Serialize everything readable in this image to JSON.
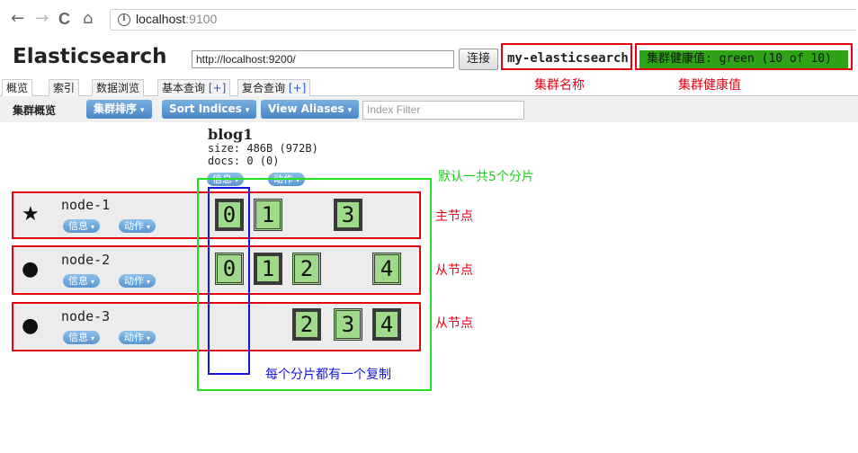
{
  "browser": {
    "nav_back": "←",
    "nav_forward": "→",
    "nav_reload": "C",
    "nav_home": "⌂",
    "info_glyph": "i",
    "url_host": "localhost",
    "url_port": ":9100"
  },
  "header": {
    "app_title": "Elasticsearch",
    "connection_url": "http://localhost:9200/",
    "connect_label": "连接",
    "cluster_name": "my-elasticsearch",
    "cluster_health": "集群健康值: green (10 of 10)",
    "health_color": "#2ea316"
  },
  "tabs": [
    {
      "label": "概览",
      "plus": ""
    },
    {
      "label": "索引",
      "plus": ""
    },
    {
      "label": "数据浏览",
      "plus": ""
    },
    {
      "label": "基本查询",
      "plus": "[+]"
    },
    {
      "label": "复合查询",
      "plus": "[+]"
    }
  ],
  "toolbar": {
    "label": "集群概览",
    "sort_cluster": "集群排序",
    "sort_indices": "Sort Indices",
    "view_aliases": "View Aliases",
    "index_filter_placeholder": "Index Filter",
    "caret": "▾"
  },
  "index": {
    "name": "blog1",
    "size": "size: 486B (972B)",
    "docs": "docs: 0 (0)",
    "info_label": "信息",
    "action_label": "动作"
  },
  "nodes": [
    {
      "name": "node-1",
      "icon": "star-icon",
      "glyph": "★",
      "info_label": "信息",
      "action_label": "动作",
      "shards": [
        "0",
        "1",
        "3"
      ]
    },
    {
      "name": "node-2",
      "icon": "circle-icon",
      "glyph": "●",
      "info_label": "信息",
      "action_label": "动作",
      "shards": [
        "0",
        "1",
        "2",
        "4"
      ]
    },
    {
      "name": "node-3",
      "icon": "circle-icon",
      "glyph": "●",
      "info_label": "信息",
      "action_label": "动作",
      "shards": [
        "2",
        "3",
        "4"
      ]
    }
  ],
  "annotations": {
    "cluster_name_note": "集群名称",
    "cluster_health_note": "集群健康值",
    "default_shards_note": "默认一共5个分片",
    "master_note": "主节点",
    "slave_note_1": "从节点",
    "slave_note_2": "从节点",
    "replica_note": "每个分片都有一个复制",
    "red": "#e60012",
    "green": "#22e022",
    "blue": "#1515e0"
  }
}
